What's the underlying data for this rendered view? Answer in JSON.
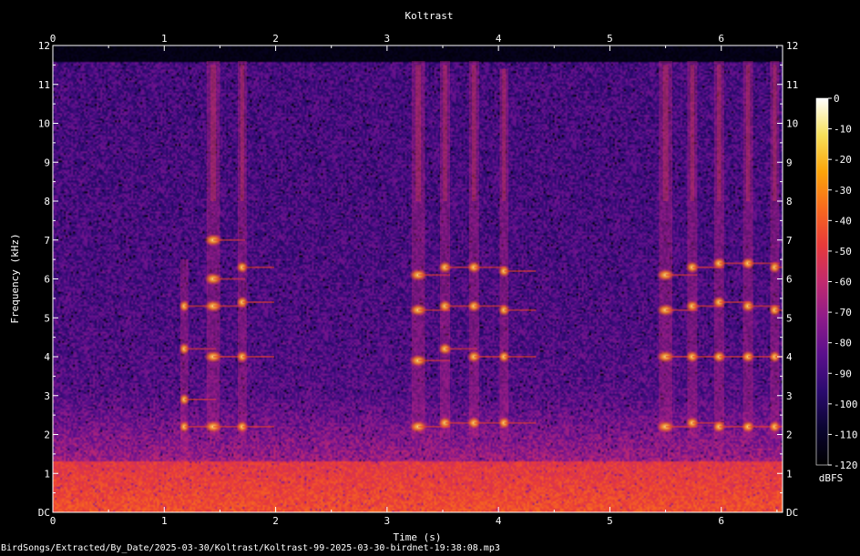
{
  "chart_data": {
    "type": "heatmap",
    "title": "Koltrast",
    "xlabel": "Time (s)",
    "ylabel": "Frequency (kHz)",
    "xlim": [
      0,
      6.55
    ],
    "ylim": [
      0,
      12
    ],
    "x_ticks": [
      "0",
      "1",
      "2",
      "3",
      "4",
      "5",
      "6"
    ],
    "y_ticks": [
      "DC",
      "1",
      "2",
      "3",
      "4",
      "5",
      "6",
      "7",
      "8",
      "9",
      "10",
      "11",
      "12"
    ],
    "colorbar": {
      "label": "dBFS",
      "range": [
        -120,
        0
      ],
      "ticks": [
        "0",
        "-10",
        "-20",
        "-30",
        "-40",
        "-50",
        "-60",
        "-70",
        "-80",
        "-90",
        "-100",
        "-110",
        "-120"
      ]
    },
    "colormap": [
      "#000000",
      "#0a0430",
      "#2a0a6e",
      "#5a0f8c",
      "#8e1b8a",
      "#c22a6e",
      "#e83a3a",
      "#f86a1e",
      "#fca50a",
      "#f6e05a",
      "#ffffff"
    ],
    "noise_floor_top_khz": 11.6,
    "low_band_khz": [
      0,
      1.3
    ],
    "calls": [
      {
        "t": 1.18,
        "f0": 1.6,
        "f1": 6.5,
        "w": 0.07,
        "bands": [
          2.2,
          2.9,
          4.2,
          5.3
        ]
      },
      {
        "t": 1.44,
        "f0": 1.9,
        "f1": 11.6,
        "w": 0.12,
        "bands": [
          2.2,
          4.0,
          5.3,
          6.0,
          7.0
        ]
      },
      {
        "t": 1.7,
        "f0": 1.9,
        "f1": 11.6,
        "w": 0.08,
        "bands": [
          2.2,
          4.0,
          5.4,
          6.3
        ]
      },
      {
        "t": 3.28,
        "f0": 1.9,
        "f1": 11.6,
        "w": 0.12,
        "bands": [
          2.2,
          3.9,
          5.2,
          6.1
        ]
      },
      {
        "t": 3.52,
        "f0": 1.9,
        "f1": 11.6,
        "w": 0.09,
        "bands": [
          2.3,
          4.2,
          5.3,
          6.3
        ]
      },
      {
        "t": 3.78,
        "f0": 1.9,
        "f1": 11.6,
        "w": 0.09,
        "bands": [
          2.3,
          4.0,
          5.3,
          6.3
        ]
      },
      {
        "t": 4.05,
        "f0": 1.9,
        "f1": 11.4,
        "w": 0.08,
        "bands": [
          2.3,
          4.0,
          5.2,
          6.2
        ]
      },
      {
        "t": 5.5,
        "f0": 1.9,
        "f1": 11.6,
        "w": 0.12,
        "bands": [
          2.2,
          4.0,
          5.2,
          6.1
        ]
      },
      {
        "t": 5.74,
        "f0": 1.9,
        "f1": 11.6,
        "w": 0.09,
        "bands": [
          2.3,
          4.0,
          5.3,
          6.3
        ]
      },
      {
        "t": 5.98,
        "f0": 1.9,
        "f1": 11.6,
        "w": 0.09,
        "bands": [
          2.2,
          4.0,
          5.4,
          6.4
        ]
      },
      {
        "t": 6.24,
        "f0": 1.9,
        "f1": 11.6,
        "w": 0.09,
        "bands": [
          2.2,
          4.0,
          5.3,
          6.4
        ]
      },
      {
        "t": 6.48,
        "f0": 1.9,
        "f1": 11.6,
        "w": 0.08,
        "bands": [
          2.2,
          4.0,
          5.2,
          6.3
        ]
      }
    ]
  },
  "footer": {
    "path": "BirdSongs/Extracted/By_Date/2025-03-30/Koltrast/Koltrast-99-2025-03-30-birdnet-19:38:08.mp3"
  }
}
